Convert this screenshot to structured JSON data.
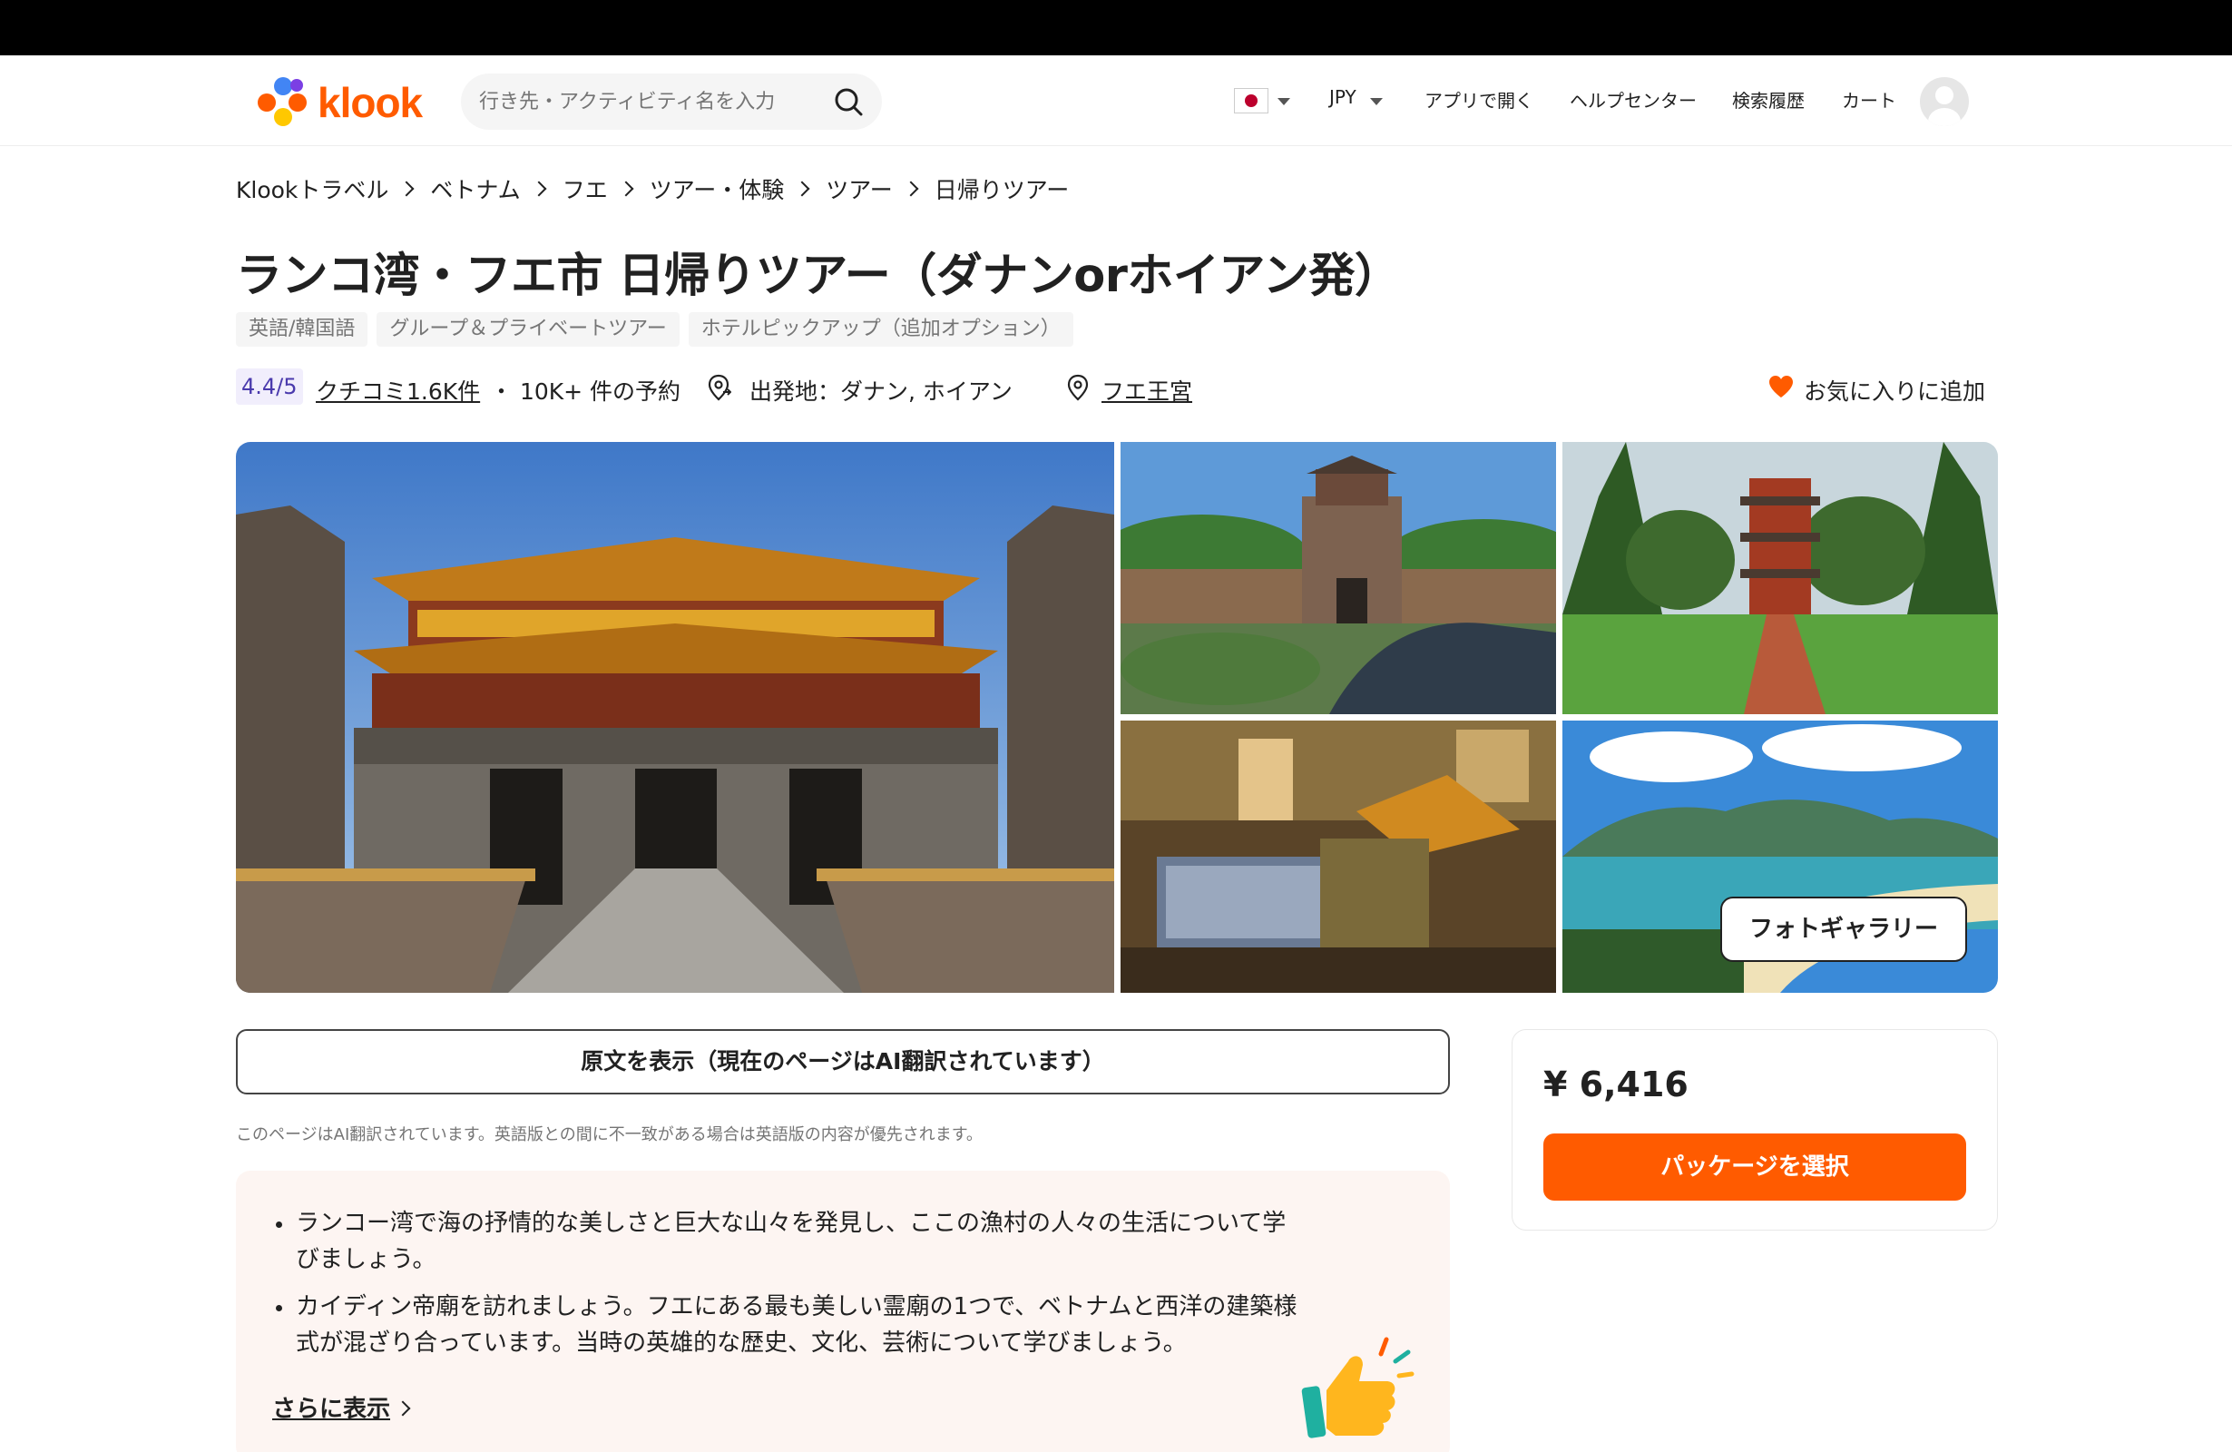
{
  "header": {
    "logo_text": "klook",
    "search_placeholder": "行き先・アクティビティ名を入力",
    "currency": "JPY",
    "nav": {
      "open_app": "アプリで開く",
      "help": "ヘルプセンター",
      "history": "検索履歴",
      "cart": "カート"
    }
  },
  "breadcrumb": [
    "Klookトラベル",
    "ベトナム",
    "フエ",
    "ツアー・体験",
    "ツアー",
    "日帰りツアー"
  ],
  "product": {
    "title": "ランコ湾・フエ市 日帰りツアー（ダナンorホイアン発）",
    "tags": [
      "英語/韓国語",
      "グループ＆プライベートツアー",
      "ホテルピックアップ（追加オプション）"
    ],
    "rating": "4.4/5",
    "reviews": "クチコミ1.6K件",
    "bookings": "・ 10K+ 件の予約",
    "departure": "出発地：ダナン, ホイアン",
    "location": "フエ王宮",
    "favorite": "お気に入りに追加"
  },
  "gallery": {
    "button": "フォトギャラリー"
  },
  "translation": {
    "button": "原文を表示（現在のページはAI翻訳されています）",
    "note": "このページはAI翻訳されています。英語版との間に不一致がある場合は英語版の内容が優先されます。"
  },
  "highlights": {
    "items": [
      "ランコー湾で海の抒情的な美しさと巨大な山々を発見し、ここの漁村の人々の生活について学びましょう。",
      "カイディン帝廟を訪れましょう。フエにある最も美しい霊廟の1つで、ベトナムと西洋の建築様式が混ざり合っています。当時の英雄的な歴史、文化、芸術について学びましょう。"
    ],
    "more": "さらに表示"
  },
  "booking": {
    "price": "¥ 6,416",
    "select_button": "パッケージを選択"
  },
  "colors": {
    "brand": "#ff5b00",
    "rating_bg": "#f1eefc",
    "rating_text": "#4a3aad",
    "highlight_bg": "#fdf5f2"
  }
}
